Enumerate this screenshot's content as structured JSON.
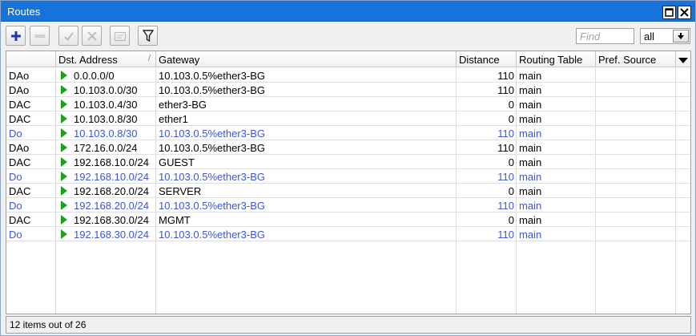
{
  "window": {
    "title": "Routes"
  },
  "toolbar": {
    "find_placeholder": "Find",
    "filter_value": "all"
  },
  "columns": [
    {
      "label": ""
    },
    {
      "label": "Dst. Address",
      "sort": "/"
    },
    {
      "label": "Gateway"
    },
    {
      "label": "Distance"
    },
    {
      "label": "Routing Table"
    },
    {
      "label": "Pref. Source"
    }
  ],
  "rows": [
    {
      "flags": "DAo",
      "dst": "0.0.0.0/0",
      "gateway": "10.103.0.5%ether3-BG",
      "distance": "110",
      "table": "main",
      "pref": "",
      "style": "normal"
    },
    {
      "flags": "DAo",
      "dst": "10.103.0.0/30",
      "gateway": "10.103.0.5%ether3-BG",
      "distance": "110",
      "table": "main",
      "pref": "",
      "style": "normal"
    },
    {
      "flags": "DAC",
      "dst": "10.103.0.4/30",
      "gateway": "ether3-BG",
      "distance": "0",
      "table": "main",
      "pref": "",
      "style": "normal"
    },
    {
      "flags": "DAC",
      "dst": "10.103.0.8/30",
      "gateway": "ether1",
      "distance": "0",
      "table": "main",
      "pref": "",
      "style": "normal"
    },
    {
      "flags": "Do",
      "dst": "10.103.0.8/30",
      "gateway": "10.103.0.5%ether3-BG",
      "distance": "110",
      "table": "main",
      "pref": "",
      "style": "blue"
    },
    {
      "flags": "DAo",
      "dst": "172.16.0.0/24",
      "gateway": "10.103.0.5%ether3-BG",
      "distance": "110",
      "table": "main",
      "pref": "",
      "style": "normal"
    },
    {
      "flags": "DAC",
      "dst": "192.168.10.0/24",
      "gateway": "GUEST",
      "distance": "0",
      "table": "main",
      "pref": "",
      "style": "normal"
    },
    {
      "flags": "Do",
      "dst": "192.168.10.0/24",
      "gateway": "10.103.0.5%ether3-BG",
      "distance": "110",
      "table": "main",
      "pref": "",
      "style": "blue"
    },
    {
      "flags": "DAC",
      "dst": "192.168.20.0/24",
      "gateway": "SERVER",
      "distance": "0",
      "table": "main",
      "pref": "",
      "style": "normal"
    },
    {
      "flags": "Do",
      "dst": "192.168.20.0/24",
      "gateway": "10.103.0.5%ether3-BG",
      "distance": "110",
      "table": "main",
      "pref": "",
      "style": "blue"
    },
    {
      "flags": "DAC",
      "dst": "192.168.30.0/24",
      "gateway": "MGMT",
      "distance": "0",
      "table": "main",
      "pref": "",
      "style": "normal"
    },
    {
      "flags": "Do",
      "dst": "192.168.30.0/24",
      "gateway": "10.103.0.5%ether3-BG",
      "distance": "110",
      "table": "main",
      "pref": "",
      "style": "blue"
    }
  ],
  "status": {
    "text": "12 items out of 26"
  },
  "colors": {
    "title_bar": "#1773dc",
    "inactive_route": "#3c55d8",
    "route_icon": "#1fa01f"
  }
}
